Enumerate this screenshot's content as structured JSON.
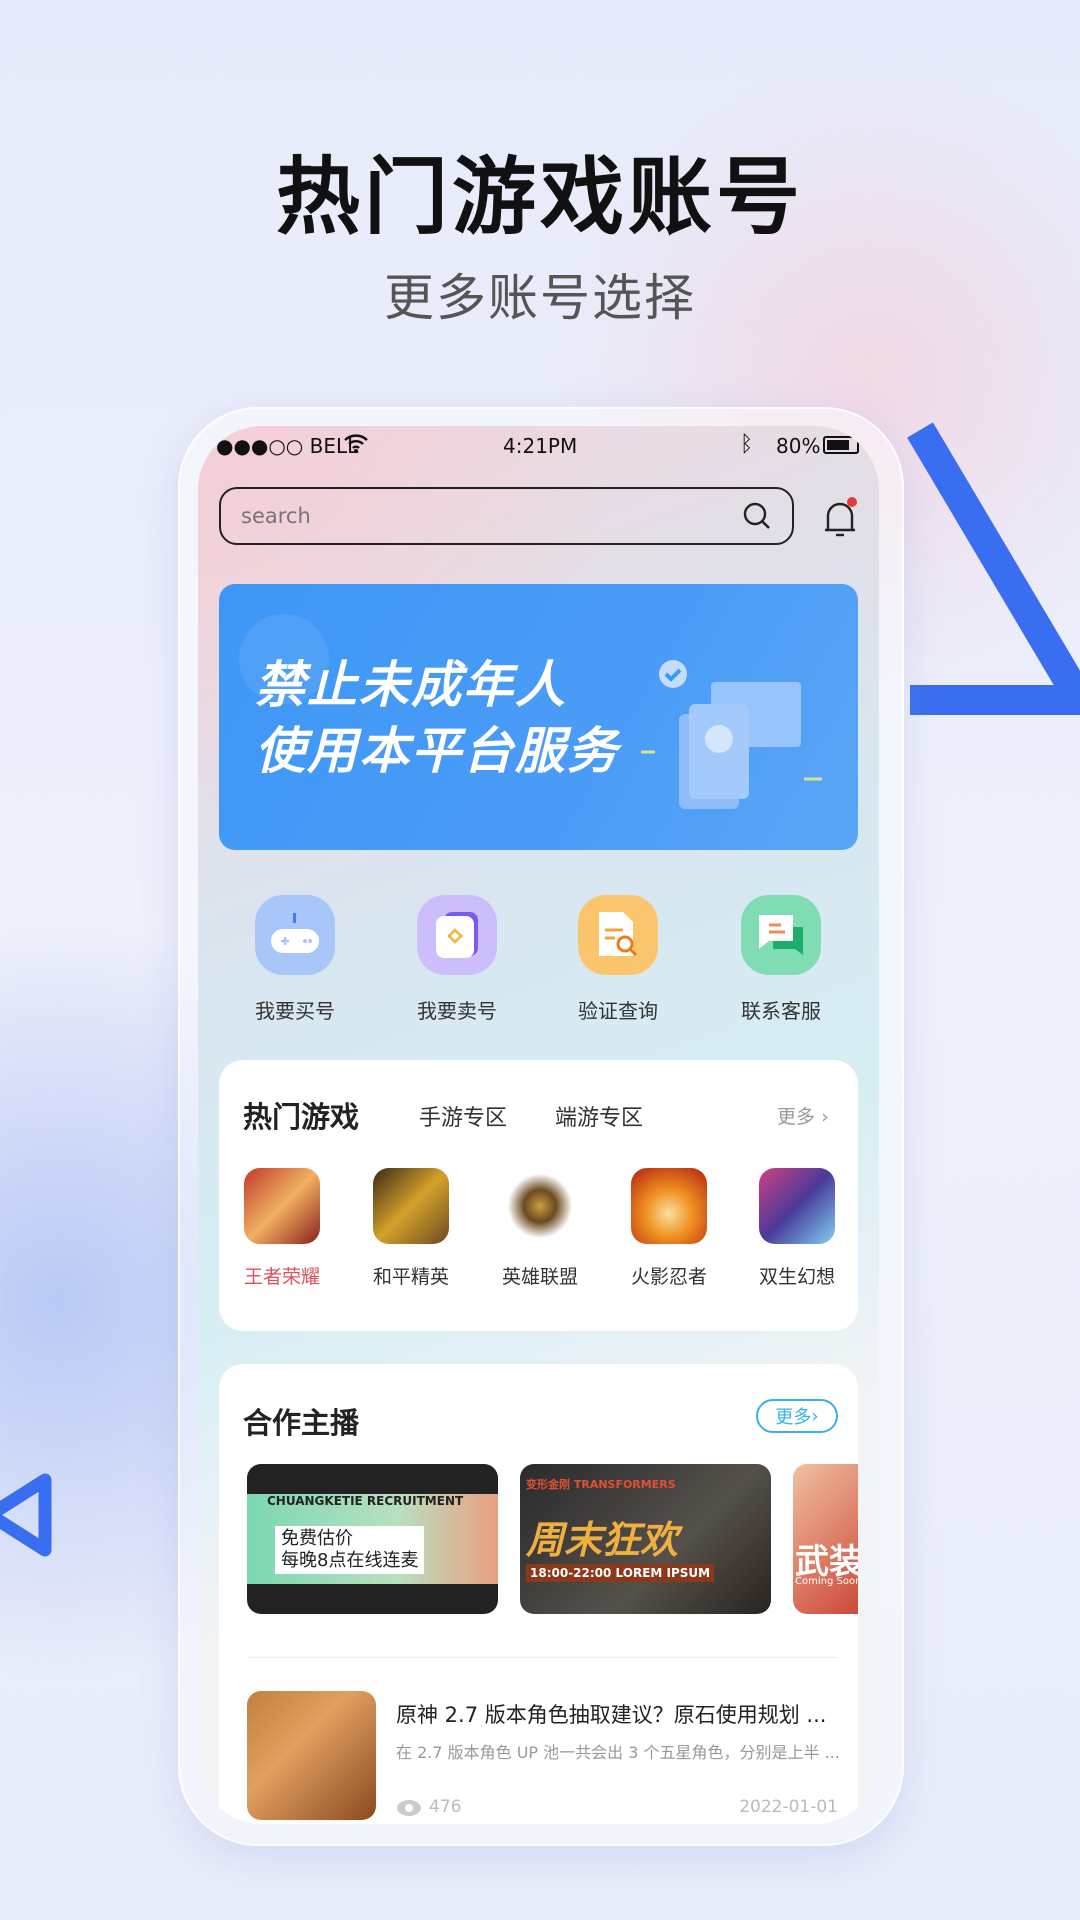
{
  "hero": {
    "title": "热门游戏账号",
    "subtitle": "更多账号选择"
  },
  "status_bar": {
    "carrier": "●●●○○ BELL",
    "time": "4:21PM",
    "battery": "80%"
  },
  "search": {
    "placeholder": "search"
  },
  "banner": {
    "line1": "禁止未成年人",
    "line2": "使用本平台服务"
  },
  "quick_actions": [
    {
      "label": "我要买号",
      "icon": "gamepad-icon",
      "color": "#a9c6fb"
    },
    {
      "label": "我要卖号",
      "icon": "sell-card-icon",
      "color": "#cdbdfb"
    },
    {
      "label": "验证查询",
      "icon": "document-search-icon",
      "color": "#fbc56e"
    },
    {
      "label": "联系客服",
      "icon": "chat-icon",
      "color": "#7fdcb3"
    }
  ],
  "hot_games": {
    "title": "热门游戏",
    "tabs": [
      "手游专区",
      "端游专区"
    ],
    "more": "更多",
    "games": [
      {
        "label": "王者荣耀",
        "active": true
      },
      {
        "label": "和平精英"
      },
      {
        "label": "英雄联盟"
      },
      {
        "label": "火影忍者"
      },
      {
        "label": "双生幻想"
      }
    ]
  },
  "streamers": {
    "title": "合作主播",
    "more": "更多",
    "banners": [
      {
        "top": "CHUANGKETIE RECRUITMENT",
        "line1": "免费估价",
        "line2": "每晚8点在线连麦"
      },
      {
        "top": "变形金刚 TRANSFORMERS",
        "line1": "周末狂欢",
        "line2": "18:00-22:00 LOREM IPSUM"
      },
      {
        "line1": "武装",
        "line2": "Coming Soon"
      }
    ]
  },
  "article": {
    "title": "原神 2.7 版本角色抽取建议？原石使用规划 ...",
    "desc": "在 2.7 版本角色 UP 池一共会出 3 个五星角色，分别是上半 ...",
    "views": "476",
    "date": "2022-01-01"
  },
  "colors": {
    "accent": "#3e97f6",
    "active_game": "#e0505a",
    "more_button": "#3ab0e6"
  }
}
